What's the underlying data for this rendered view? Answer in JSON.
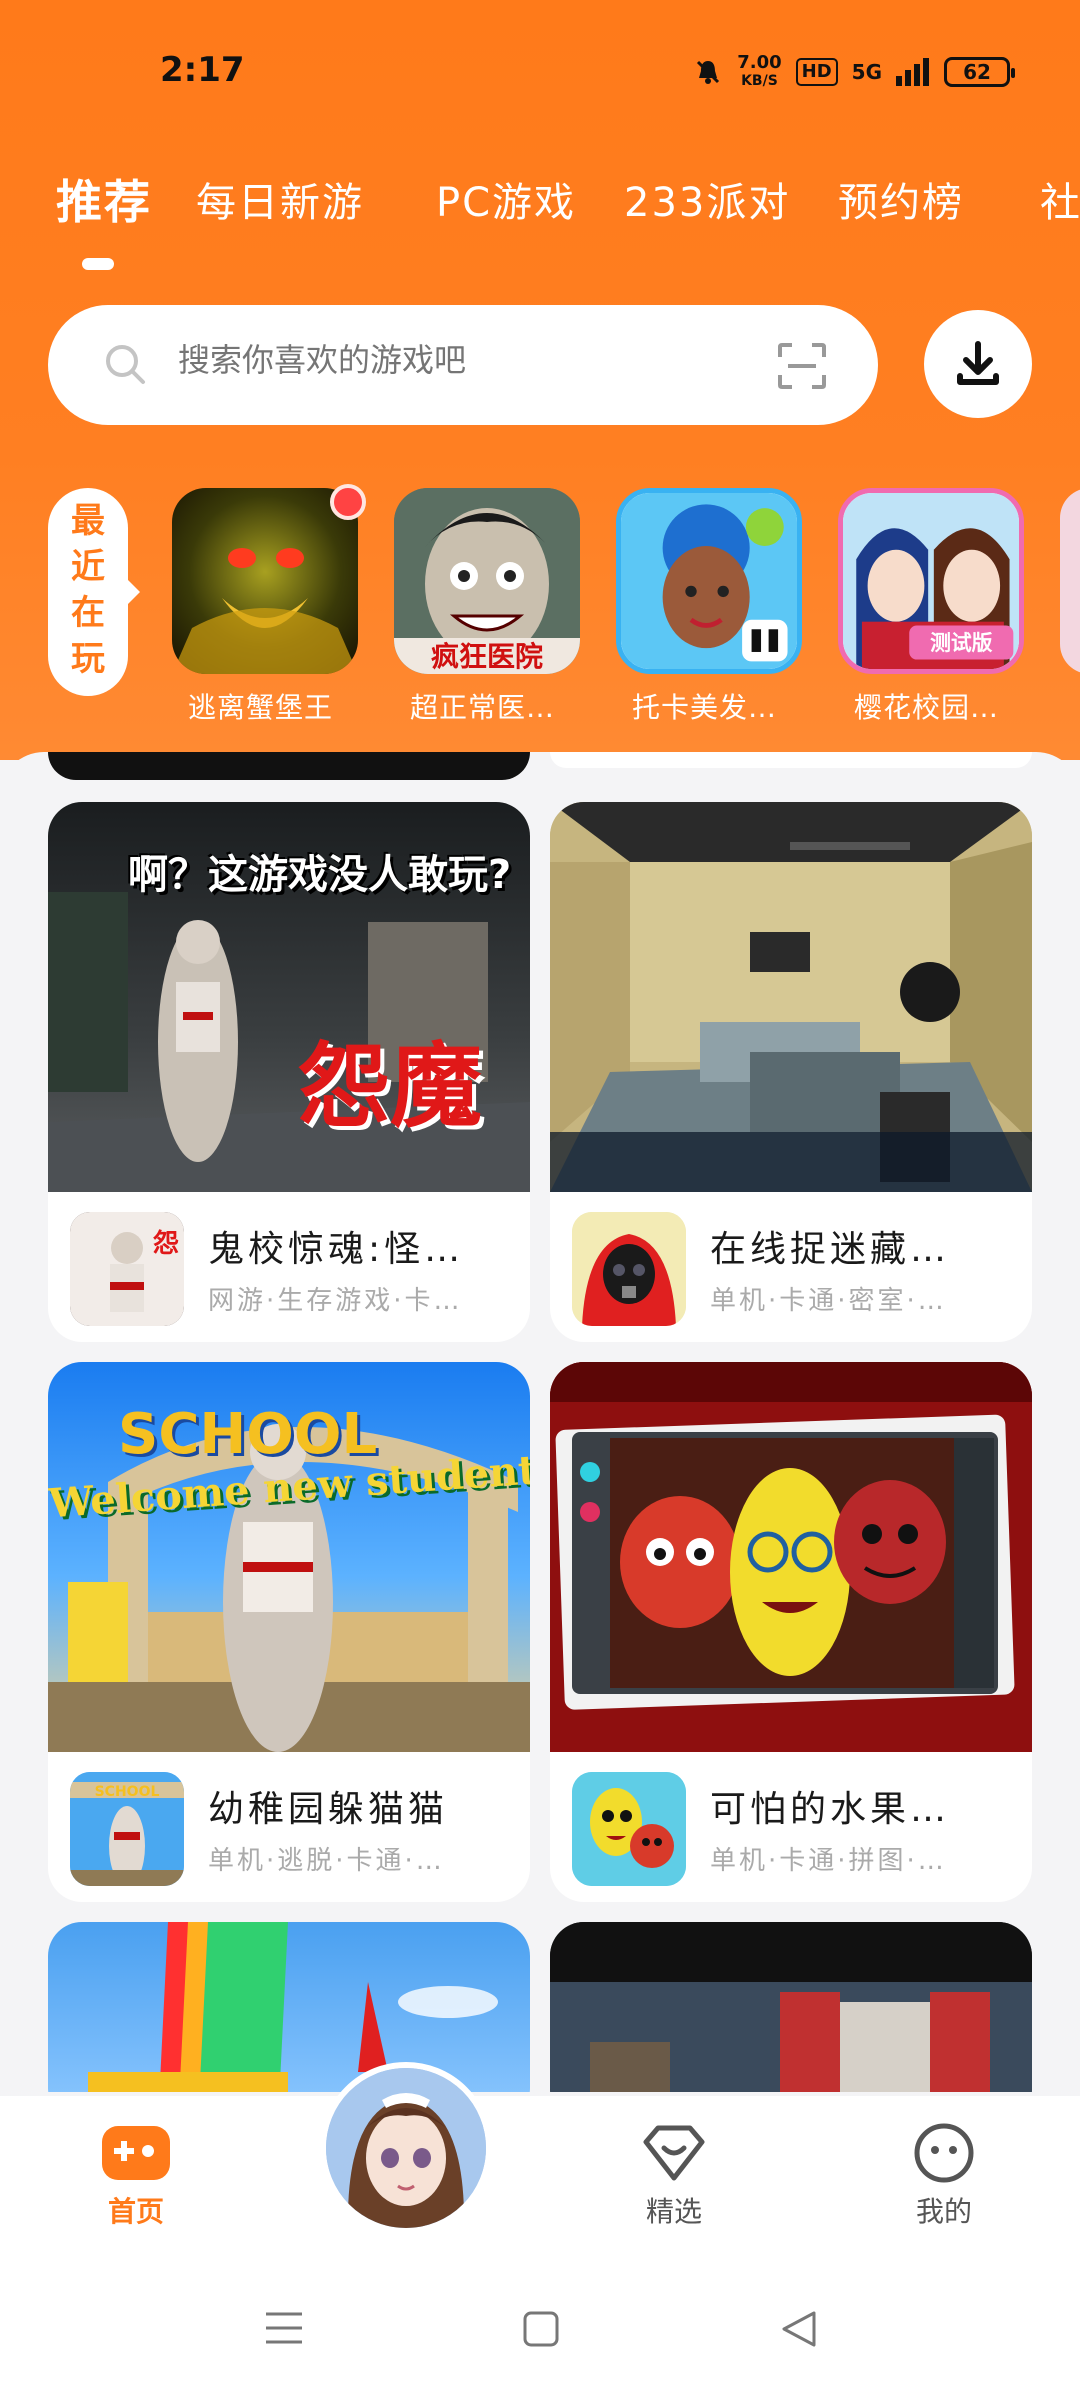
{
  "status": {
    "time": "2:17",
    "net_speed": "7.00",
    "net_unit": "KB/S",
    "hd": "HD",
    "signal": "5G",
    "battery": "62"
  },
  "tabs": [
    {
      "label": "推荐",
      "active": true
    },
    {
      "label": "每日新游"
    },
    {
      "label": "PC游戏"
    },
    {
      "label": "233派对"
    },
    {
      "label": "预约榜"
    },
    {
      "label": "社"
    }
  ],
  "search": {
    "placeholder": "搜索你喜欢的游戏吧"
  },
  "recent": {
    "label": "最近在玩",
    "items": [
      {
        "name": "逃离蟹堡王"
      },
      {
        "name": "超正常医…"
      },
      {
        "name": "托卡美发…"
      },
      {
        "name": "樱花校园…"
      }
    ]
  },
  "cards": [
    {
      "title": "鬼校惊魂:怪…",
      "tags": "网游·生存游戏·卡…",
      "overlay": "啊？这游戏没人敢玩?",
      "overlay2": "怨魔"
    },
    {
      "title": "在线捉迷藏…",
      "tags": "单机·卡通·密室·…"
    },
    {
      "title": "幼稚园躲猫猫",
      "tags": "单机·逃脱·卡通·…",
      "overlay": "SCHOOL",
      "overlay2": "Welcome new students!"
    },
    {
      "title": "可怕的水果…",
      "tags": "单机·卡通·拼图·…"
    }
  ],
  "nav": {
    "home": "首页",
    "featured": "精选",
    "mine": "我的"
  },
  "colors": {
    "accent": "#ff7a1a",
    "badge": "#ff4343"
  }
}
